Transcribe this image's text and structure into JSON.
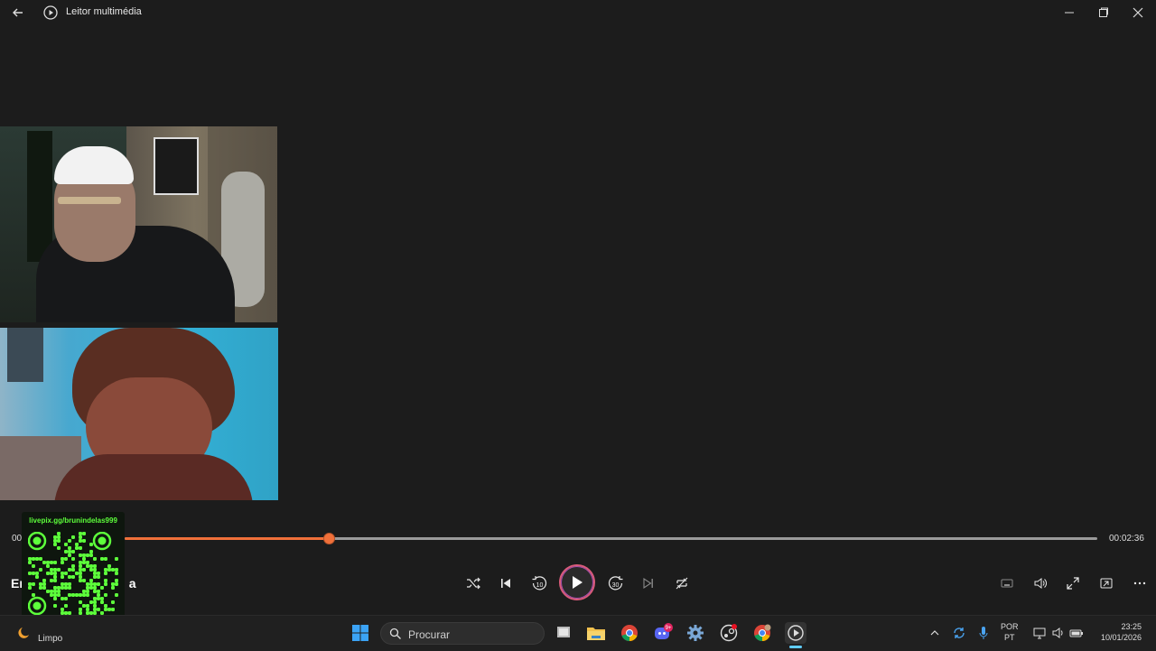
{
  "window": {
    "title": "Leitor multimédia",
    "back_icon": "arrow-left-icon",
    "app_icon": "media-player-icon",
    "controls": [
      "minimize-icon",
      "restore-icon",
      "close-icon"
    ]
  },
  "player": {
    "elapsed": "00",
    "total": "00:02:36",
    "progress": 0.21,
    "title_visible": "Er",
    "title_suffix_visible": "a",
    "accent": "#f0703a"
  },
  "overlay": {
    "url": "livepix.gg/brunindelas999",
    "qr_color": "#5dff3b"
  },
  "controls": {
    "shuffle": "shuffle-icon",
    "previous": "previous-icon",
    "rewind": "10",
    "play": "play-icon",
    "forward": "30",
    "next": "next-icon",
    "repeat": "repeat-icon",
    "right_controls": [
      "miniplayer-icon",
      "volume-icon",
      "fullscreen-icon",
      "cast-icon",
      "more-icon"
    ]
  },
  "taskbar": {
    "weather": "Limpo",
    "search_placeholder": "Procurar",
    "lang_top": "POR",
    "lang_bottom": "PT",
    "time": "23:25",
    "date": "10/01/2026",
    "discord_badge": "9+"
  }
}
